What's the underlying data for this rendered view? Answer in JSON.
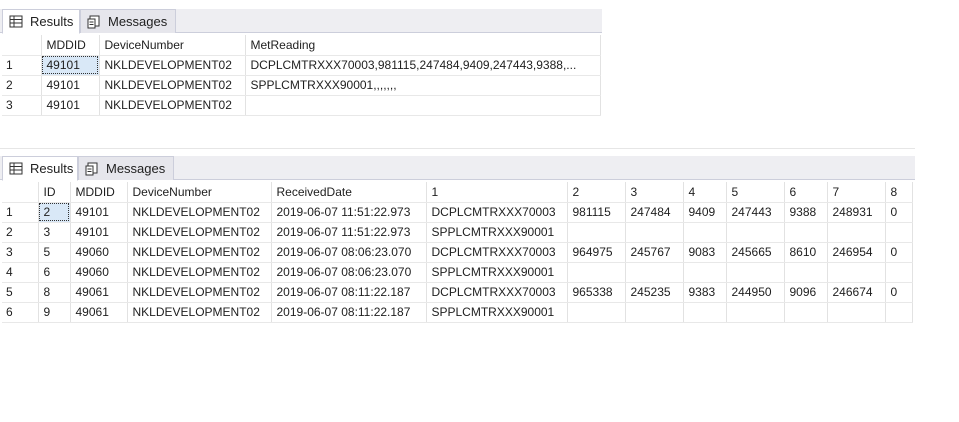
{
  "panel1": {
    "tabs": {
      "results": "Results",
      "messages": "Messages"
    },
    "columns": [
      "MDDID",
      "DeviceNumber",
      "MetReading"
    ],
    "rows": [
      {
        "n": "1",
        "cells": [
          "49101",
          "NKLDEVELOPMENT02",
          "DCPLCMTRXXX70003,981115,247484,9409,247443,9388,..."
        ]
      },
      {
        "n": "2",
        "cells": [
          "49101",
          "NKLDEVELOPMENT02",
          "SPPLCMTRXXX90001,,,,,,,"
        ]
      },
      {
        "n": "3",
        "cells": [
          "49101",
          "NKLDEVELOPMENT02",
          ""
        ]
      }
    ]
  },
  "panel2": {
    "tabs": {
      "results": "Results",
      "messages": "Messages"
    },
    "columns": [
      "ID",
      "MDDID",
      "DeviceNumber",
      "ReceivedDate",
      "1",
      "2",
      "3",
      "4",
      "5",
      "6",
      "7",
      "8"
    ],
    "rows": [
      {
        "n": "1",
        "cells": [
          "2",
          "49101",
          "NKLDEVELOPMENT02",
          "2019-06-07 11:51:22.973",
          "DCPLCMTRXXX70003",
          "981115",
          "247484",
          "9409",
          "247443",
          "9388",
          "248931",
          "0"
        ]
      },
      {
        "n": "2",
        "cells": [
          "3",
          "49101",
          "NKLDEVELOPMENT02",
          "2019-06-07 11:51:22.973",
          "SPPLCMTRXXX90001",
          "",
          "",
          "",
          "",
          "",
          "",
          ""
        ]
      },
      {
        "n": "3",
        "cells": [
          "5",
          "49060",
          "NKLDEVELOPMENT02",
          "2019-06-07 08:06:23.070",
          "DCPLCMTRXXX70003",
          "964975",
          "245767",
          "9083",
          "245665",
          "8610",
          "246954",
          "0"
        ]
      },
      {
        "n": "4",
        "cells": [
          "6",
          "49060",
          "NKLDEVELOPMENT02",
          "2019-06-07 08:06:23.070",
          "SPPLCMTRXXX90001",
          "",
          "",
          "",
          "",
          "",
          "",
          ""
        ]
      },
      {
        "n": "5",
        "cells": [
          "8",
          "49061",
          "NKLDEVELOPMENT02",
          "2019-06-07 08:11:22.187",
          "DCPLCMTRXXX70003",
          "965338",
          "245235",
          "9383",
          "244950",
          "9096",
          "246674",
          "0"
        ]
      },
      {
        "n": "6",
        "cells": [
          "9",
          "49061",
          "NKLDEVELOPMENT02",
          "2019-06-07 08:11:22.187",
          "SPPLCMTRXXX90001",
          "",
          "",
          "",
          "",
          "",
          "",
          ""
        ]
      }
    ]
  }
}
